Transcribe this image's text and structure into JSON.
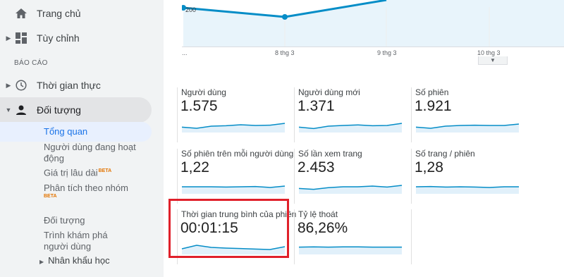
{
  "sidebar": {
    "home": {
      "label": "Trang chủ",
      "icon": "home-icon"
    },
    "customize": {
      "label": "Tùy chỉnh",
      "icon": "dashboard-icon"
    },
    "section_reports": "BÁO CÁO",
    "realtime": {
      "label": "Thời gian thực",
      "icon": "clock-icon"
    },
    "audience": {
      "label": "Đối tượng",
      "icon": "person-icon"
    },
    "audience_items": [
      {
        "label": "Tổng quan",
        "active": true
      },
      {
        "label": "Người dùng đang hoạt động"
      },
      {
        "label": "Giá trị lâu dài",
        "badge": "BETA"
      },
      {
        "label": "Phân tích theo nhóm",
        "badge": "BETA"
      },
      {
        "label": "Đối tượng"
      },
      {
        "label": "Trình khám phá người dùng"
      },
      {
        "label": "Nhân khẩu học"
      }
    ]
  },
  "chart": {
    "y_tick": "200",
    "x_ticks": [
      "...",
      "8 thg 3",
      "9 thg 3",
      "10 thg 3"
    ],
    "accent_color": "#058dc7"
  },
  "metrics": [
    {
      "label": "Người dùng",
      "value": "1.575",
      "spark": [
        0.62,
        0.7,
        0.55,
        0.52,
        0.45,
        0.5,
        0.48,
        0.35
      ]
    },
    {
      "label": "Người dùng mới",
      "value": "1.371",
      "spark": [
        0.62,
        0.72,
        0.55,
        0.5,
        0.46,
        0.52,
        0.5,
        0.35
      ]
    },
    {
      "label": "Số phiên",
      "value": "1.921",
      "spark": [
        0.62,
        0.7,
        0.55,
        0.5,
        0.48,
        0.5,
        0.5,
        0.4
      ]
    },
    {
      "label": "Số phiên trên mỗi người dùng",
      "value": "1,22",
      "spark": [
        0.5,
        0.5,
        0.5,
        0.52,
        0.5,
        0.48,
        0.55,
        0.45
      ]
    },
    {
      "label": "Số lần xem trang",
      "value": "2.453",
      "spark": [
        0.62,
        0.68,
        0.56,
        0.5,
        0.5,
        0.45,
        0.52,
        0.4
      ]
    },
    {
      "label": "Số trang / phiên",
      "value": "1,28",
      "spark": [
        0.5,
        0.48,
        0.52,
        0.5,
        0.52,
        0.55,
        0.5,
        0.5
      ]
    },
    {
      "label": "Thời gian trung bình của phiên",
      "value": "00:01:15",
      "spark": [
        0.6,
        0.35,
        0.5,
        0.55,
        0.58,
        0.62,
        0.65,
        0.45
      ]
    },
    {
      "label": "Tỷ lệ thoát",
      "value": "86,26%",
      "spark": [
        0.48,
        0.46,
        0.48,
        0.46,
        0.46,
        0.48,
        0.48,
        0.48
      ]
    }
  ],
  "colors": {
    "sparkline": "#058dc7",
    "sparkfill": "#e1f0fa",
    "highlight": "#e0202a"
  }
}
